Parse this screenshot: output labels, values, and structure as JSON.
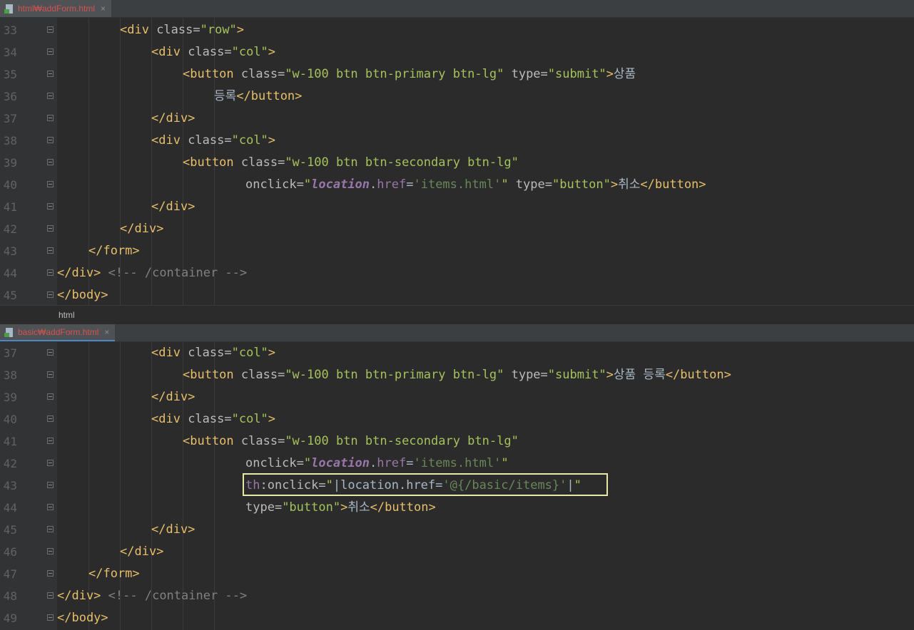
{
  "top_tab": {
    "label": "html₩addForm.html",
    "close": "×"
  },
  "bottom_tab": {
    "label": "basic₩addForm.html",
    "close": "×"
  },
  "breadcrumb": "html",
  "top_lines": [
    {
      "n": "33",
      "parts": [
        [
          "t",
          "<div "
        ],
        [
          "a",
          "class="
        ],
        [
          "s",
          "\"row\""
        ],
        [
          "t",
          ">"
        ]
      ]
    },
    {
      "n": "34",
      "parts": [
        [
          "t",
          "<div "
        ],
        [
          "a",
          "class="
        ],
        [
          "s",
          "\"col\""
        ],
        [
          "t",
          ">"
        ]
      ]
    },
    {
      "n": "35",
      "parts": [
        [
          "t",
          "<button "
        ],
        [
          "a",
          "class="
        ],
        [
          "s",
          "\"w-100 btn btn-primary btn-lg\""
        ],
        [
          "a",
          " type="
        ],
        [
          "s",
          "\"submit\""
        ],
        [
          "t",
          ">"
        ],
        [
          "x",
          "상품"
        ]
      ]
    },
    {
      "n": "36",
      "parts": [
        [
          "x",
          "등록"
        ],
        [
          "t",
          "</button>"
        ]
      ]
    },
    {
      "n": "37",
      "parts": [
        [
          "t",
          "</div>"
        ]
      ]
    },
    {
      "n": "38",
      "parts": [
        [
          "t",
          "<div "
        ],
        [
          "a",
          "class="
        ],
        [
          "s",
          "\"col\""
        ],
        [
          "t",
          ">"
        ]
      ]
    },
    {
      "n": "39",
      "parts": [
        [
          "t",
          "<button "
        ],
        [
          "a",
          "class="
        ],
        [
          "s",
          "\"w-100 btn btn-secondary btn-lg\""
        ]
      ]
    },
    {
      "n": "40",
      "parts": [
        [
          "a",
          "onclick="
        ],
        [
          "s",
          "\""
        ],
        [
          "k",
          "location"
        ],
        [
          "x",
          "."
        ],
        [
          "p",
          "href"
        ],
        [
          "x",
          "="
        ],
        [
          "sq",
          "'items.html'"
        ],
        [
          "s",
          "\""
        ],
        [
          "a",
          " type="
        ],
        [
          "s",
          "\"button\""
        ],
        [
          "t",
          ">"
        ],
        [
          "x",
          "취소"
        ],
        [
          "t",
          "</button>"
        ]
      ]
    },
    {
      "n": "41",
      "parts": [
        [
          "t",
          "</div>"
        ]
      ]
    },
    {
      "n": "42",
      "parts": [
        [
          "t",
          "</div>"
        ]
      ]
    },
    {
      "n": "43",
      "parts": [
        [
          "t",
          "</form>"
        ]
      ]
    },
    {
      "n": "44",
      "parts": [
        [
          "t",
          "</div>"
        ],
        [
          "x",
          " "
        ],
        [
          "c",
          "<!-- /container -->"
        ]
      ]
    },
    {
      "n": "45",
      "parts": [
        [
          "t",
          "</body>"
        ]
      ]
    }
  ],
  "bottom_lines": [
    {
      "n": "37",
      "parts": [
        [
          "t",
          "<div "
        ],
        [
          "a",
          "class="
        ],
        [
          "s",
          "\"col\""
        ],
        [
          "t",
          ">"
        ]
      ]
    },
    {
      "n": "38",
      "parts": [
        [
          "t",
          "<button "
        ],
        [
          "a",
          "class="
        ],
        [
          "s",
          "\"w-100 btn btn-primary btn-lg\""
        ],
        [
          "a",
          " type="
        ],
        [
          "s",
          "\"submit\""
        ],
        [
          "t",
          ">"
        ],
        [
          "x",
          "상품 등록"
        ],
        [
          "t",
          "</button>"
        ]
      ]
    },
    {
      "n": "39",
      "parts": [
        [
          "t",
          "</div>"
        ]
      ]
    },
    {
      "n": "40",
      "parts": [
        [
          "t",
          "<div "
        ],
        [
          "a",
          "class="
        ],
        [
          "s",
          "\"col\""
        ],
        [
          "t",
          ">"
        ]
      ]
    },
    {
      "n": "41",
      "parts": [
        [
          "t",
          "<button "
        ],
        [
          "a",
          "class="
        ],
        [
          "s",
          "\"w-100 btn btn-secondary btn-lg\""
        ]
      ]
    },
    {
      "n": "42",
      "parts": [
        [
          "a",
          "onclick="
        ],
        [
          "s",
          "\""
        ],
        [
          "k",
          "location"
        ],
        [
          "x",
          "."
        ],
        [
          "p",
          "href"
        ],
        [
          "x",
          "="
        ],
        [
          "sq",
          "'items.html'"
        ],
        [
          "s",
          "\""
        ]
      ]
    },
    {
      "n": "43",
      "parts": [
        [
          "p",
          "th"
        ],
        [
          "a",
          ":onclick="
        ],
        [
          "s",
          "\""
        ],
        [
          "x",
          "|location.href="
        ],
        [
          "sq",
          "'@{/basic/items}'"
        ],
        [
          "x",
          "|"
        ],
        [
          "s",
          "\""
        ]
      ]
    },
    {
      "n": "44",
      "parts": [
        [
          "a",
          "type="
        ],
        [
          "s",
          "\"button\""
        ],
        [
          "t",
          ">"
        ],
        [
          "x",
          "취소"
        ],
        [
          "t",
          "</button>"
        ]
      ]
    },
    {
      "n": "45",
      "parts": [
        [
          "t",
          "</div>"
        ]
      ]
    },
    {
      "n": "46",
      "parts": [
        [
          "t",
          "</div>"
        ]
      ]
    },
    {
      "n": "47",
      "parts": [
        [
          "t",
          "</form>"
        ]
      ]
    },
    {
      "n": "48",
      "parts": [
        [
          "t",
          "</div>"
        ],
        [
          "x",
          " "
        ],
        [
          "c",
          "<!-- /container -->"
        ]
      ]
    },
    {
      "n": "49",
      "parts": [
        [
          "t",
          "</body>"
        ]
      ]
    }
  ]
}
